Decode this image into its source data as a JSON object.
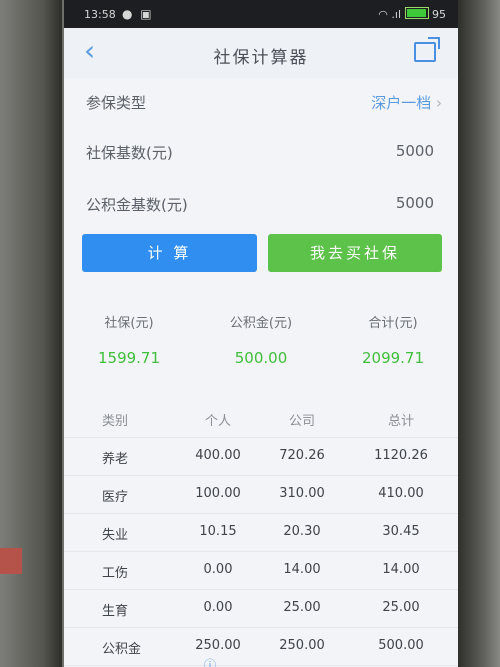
{
  "status_bar": {
    "time": "13:58",
    "battery": "95"
  },
  "header": {
    "title": "社保计算器"
  },
  "form": {
    "insure_type_label": "参保类型",
    "insure_type_value": "深户一档",
    "social_base_label": "社保基数(元)",
    "social_base_value": "5000",
    "fund_base_label": "公积金基数(元)",
    "fund_base_value": "5000"
  },
  "buttons": {
    "calculate": "计 算",
    "buy": "我去买社保"
  },
  "summary": [
    {
      "label": "社保(元)",
      "value": "1599.71"
    },
    {
      "label": "公积金(元)",
      "value": "500.00"
    },
    {
      "label": "合计(元)",
      "value": "2099.71"
    }
  ],
  "table": {
    "headers": [
      "类别",
      "个人",
      "公司",
      "总计"
    ],
    "rows": [
      [
        "养老",
        "400.00",
        "720.26",
        "1120.26"
      ],
      [
        "医疗",
        "100.00",
        "310.00",
        "410.00"
      ],
      [
        "失业",
        "10.15",
        "20.30",
        "30.45"
      ],
      [
        "工伤",
        "0.00",
        "14.00",
        "14.00"
      ],
      [
        "生育",
        "0.00",
        "25.00",
        "25.00"
      ],
      [
        "公积金",
        "250.00",
        "250.00",
        "500.00"
      ]
    ]
  },
  "colors": {
    "primary_blue": "#2f8ef0",
    "green": "#5cc24a",
    "value_green": "#3fbf3a"
  }
}
